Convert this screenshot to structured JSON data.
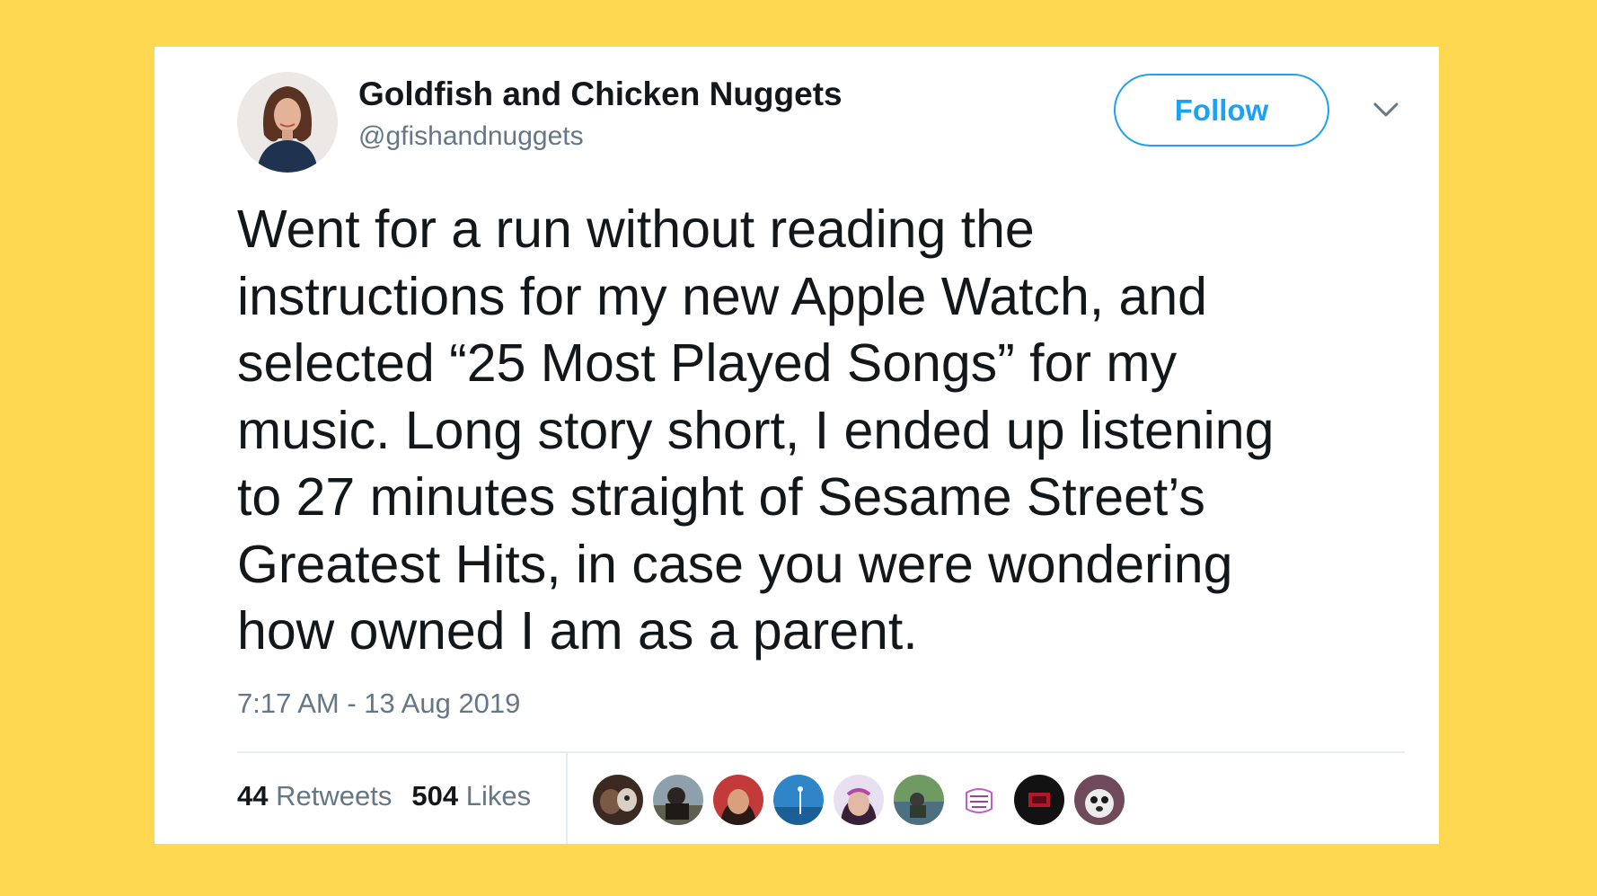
{
  "tweet": {
    "display_name": "Goldfish and Chicken Nuggets",
    "handle": "@gfishandnuggets",
    "follow_label": "Follow",
    "text": "Went for a run without reading the\ninstructions for my new Apple Watch, and\nselected “25 Most Played Songs” for my\nmusic.  Long story short, I ended up listening\nto 27 minutes straight of Sesame Street’s\nGreatest Hits, in case you were wondering\nhow owned I am as a parent.",
    "timestamp": "7:17 AM - 13 Aug 2019",
    "retweets_count": "44",
    "retweets_label": "Retweets",
    "likes_count": "504",
    "likes_label": "Likes"
  },
  "icons": {
    "menu": "chevron-down-icon"
  },
  "colors": {
    "background": "#FFD852",
    "card": "#FFFFFF",
    "accent": "#1DA1F2",
    "primary_text": "#14171A",
    "secondary_text": "#657786",
    "divider": "#E6ECF0"
  }
}
